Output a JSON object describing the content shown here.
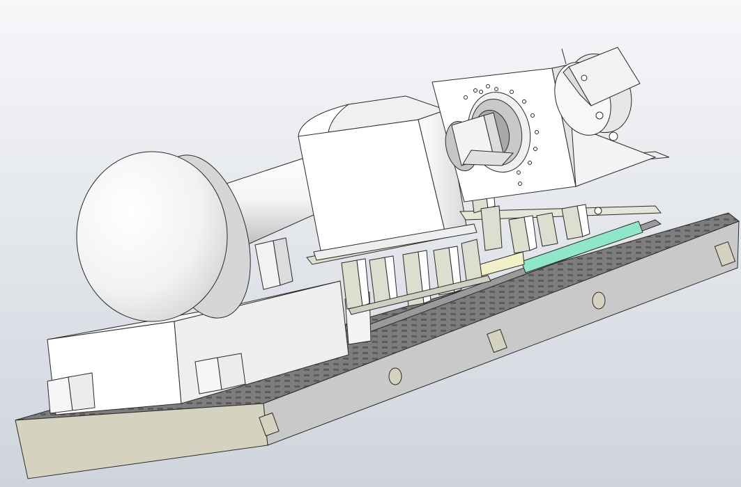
{
  "viewport": {
    "background_top": "#f6f7f9",
    "background_bottom": "#cfd4dc"
  },
  "model": {
    "colors": {
      "face_light": "#ffffff",
      "face_mid": "#e9e9e9",
      "face_shade": "#bdbdbd",
      "base_front": "#d5d3c0",
      "base_side": "#c9c9c9",
      "base_top": "#8a8a8a",
      "edge": "#2a2a2a",
      "teal_strip": "#8fe6c9",
      "yellow_strip": "#f2f0c8",
      "post": "#ddddd0"
    },
    "parts": [
      "base-plate",
      "left-motor-housing",
      "spindle-disc",
      "spindle-shaft",
      "spindle-housing",
      "flange-block",
      "sensor-box",
      "support-posts",
      "linear-rail"
    ]
  }
}
